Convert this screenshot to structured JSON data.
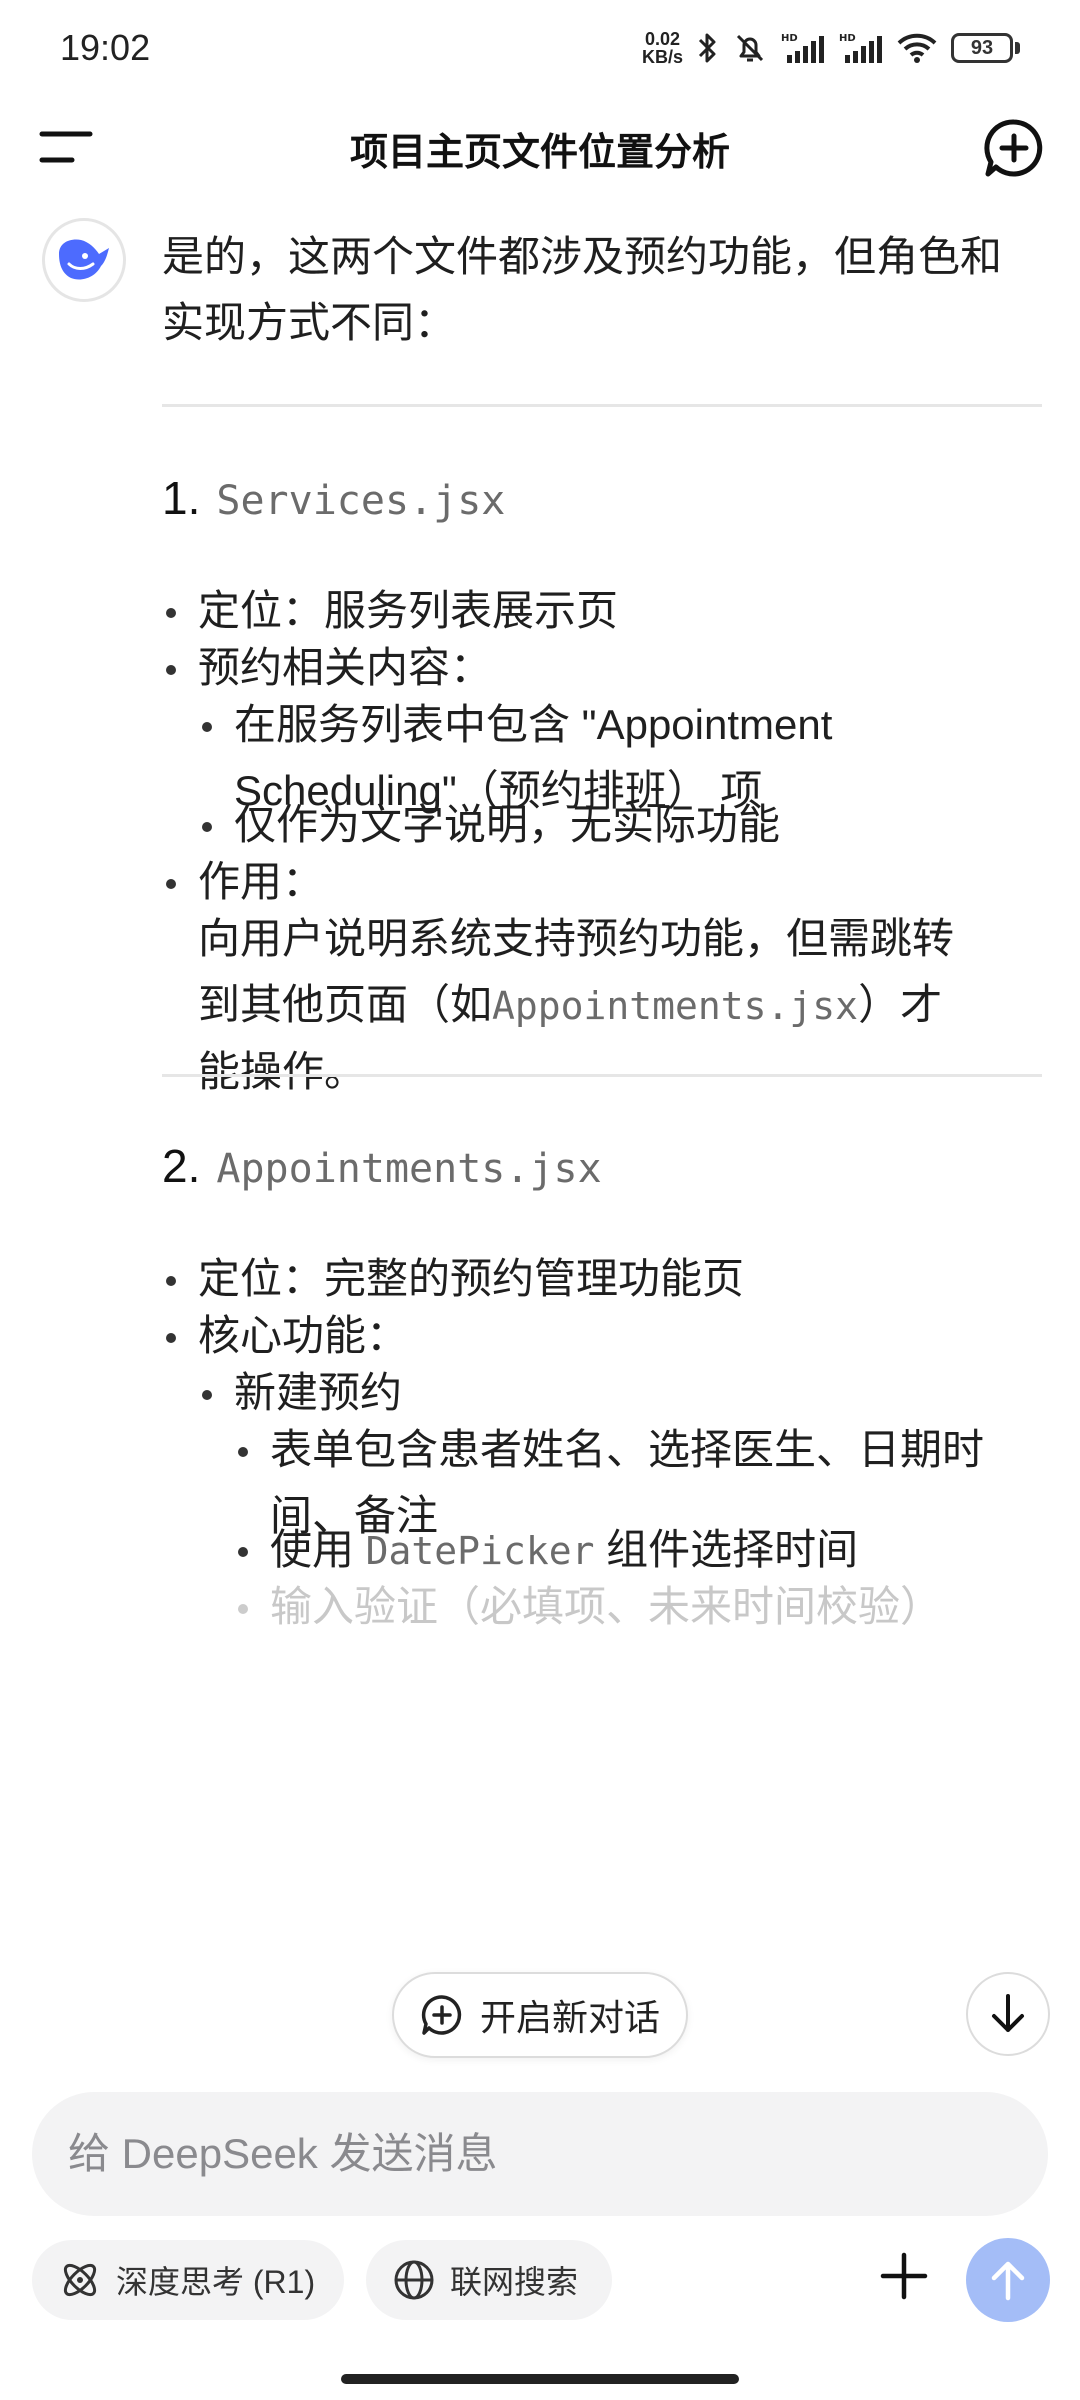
{
  "status_bar": {
    "time": "19:02",
    "net_speed_value": "0.02",
    "net_speed_unit": "KB/s",
    "battery": "93"
  },
  "header": {
    "title": "项目主页文件位置分析"
  },
  "message": {
    "intro": "是的，这两个文件都涉及预约功能，但角色和实现方式不同：",
    "section1": {
      "number": "1.",
      "file": "Services.jsx",
      "item_positioning": "定位：服务列表展示页",
      "item_booking": "预约相关内容：",
      "sub_item_1_line1": "在服务列表中包含 \"Appointment",
      "sub_item_1_line2": "Scheduling\"（预约排班） 项",
      "sub_item_2": "仅作为文字说明，无实际功能",
      "item_role": "作用：",
      "role_line1": "向用户说明系统支持预约功能，但需跳转",
      "role_line2_prefix": "到其他页面（如",
      "role_line2_code": "Appointments.jsx",
      "role_line2_suffix": "）才",
      "role_line3": "能操作。"
    },
    "section2": {
      "number": "2.",
      "file": "Appointments.jsx",
      "item_positioning": "定位：完整的预约管理功能页",
      "item_core": "核心功能：",
      "sub_item_new": "新建预约",
      "subsub_1_line1": "表单包含患者姓名、选择医生、日期时",
      "subsub_1_line2": "间、备注",
      "subsub_2_prefix": "使用 ",
      "subsub_2_code": "DatePicker",
      "subsub_2_suffix": " 组件选择时间",
      "subsub_3_partial": "输入验证（必填项、未来时间校验）"
    }
  },
  "floating": {
    "new_chat_label": "开启新对话"
  },
  "composer": {
    "placeholder": "给 DeepSeek 发送消息",
    "deep_think_label": "深度思考 (R1)",
    "web_search_label": "联网搜索"
  },
  "colors": {
    "accent": "#4d6bfe",
    "send_disabled": "#a4bdf7",
    "input_bg": "#f3f3f4"
  }
}
